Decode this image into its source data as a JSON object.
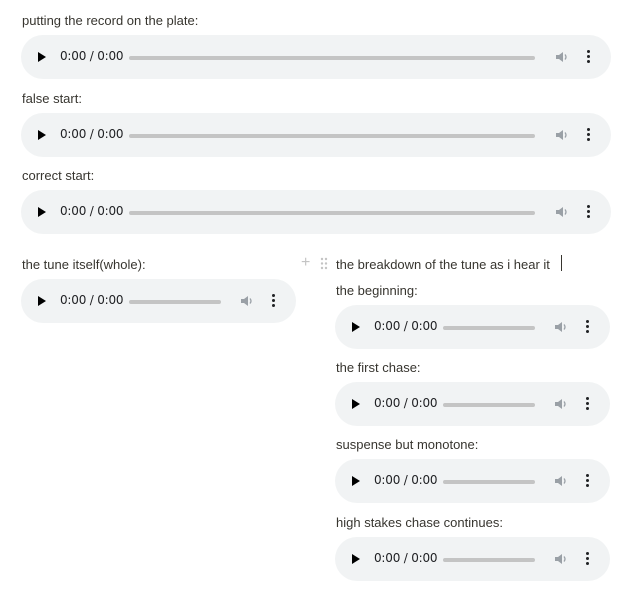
{
  "blocks": [
    {
      "label": "putting the record on the plate:",
      "time": "0:00 / 0:00"
    },
    {
      "label": "false start:",
      "time": "0:00 / 0:00"
    },
    {
      "label": "correct start:",
      "time": "0:00 / 0:00"
    }
  ],
  "left_column": {
    "label": "the tune itself(whole):",
    "time": "0:00 / 0:00"
  },
  "right_column": {
    "heading": "the breakdown of the tune as i hear it",
    "items": [
      {
        "label": "the beginning:",
        "time": "0:00 / 0:00"
      },
      {
        "label": "the first chase:",
        "time": "0:00 / 0:00"
      },
      {
        "label": "suspense but monotone:",
        "time": "0:00 / 0:00"
      },
      {
        "label": "high stakes chase continues:",
        "time": "0:00 / 0:00"
      }
    ]
  },
  "icons": {
    "play": "play-icon",
    "volume": "volume-icon",
    "menu": "more-vert-icon",
    "add": "plus-icon",
    "drag": "drag-handle-icon"
  },
  "colors": {
    "player_bg": "#f1f3f4",
    "track": "#c4c4c4",
    "text": "#37352f"
  }
}
